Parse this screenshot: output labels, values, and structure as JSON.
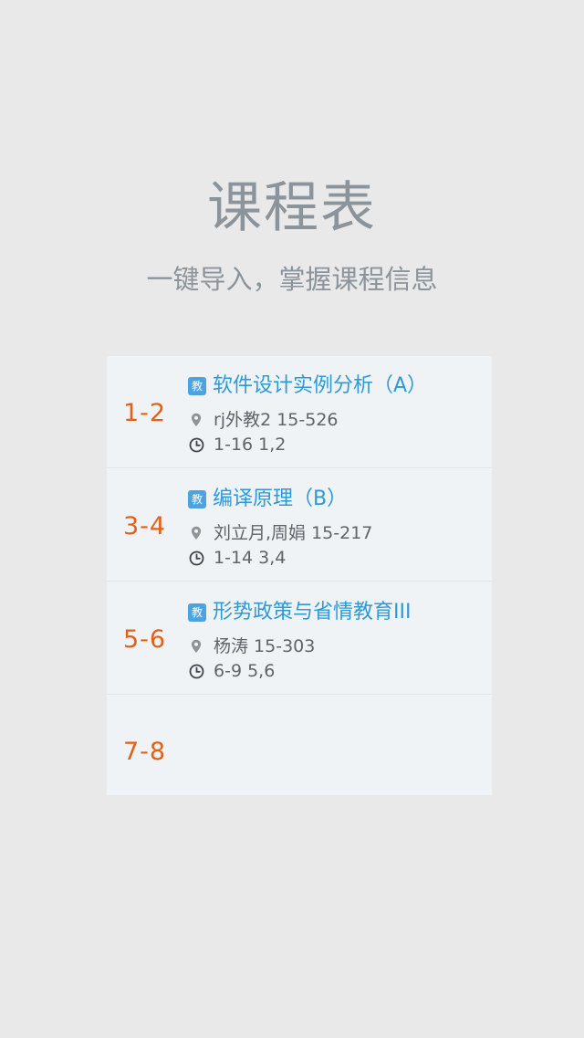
{
  "header": {
    "title": "课程表",
    "subtitle": "一键导入，掌握课程信息"
  },
  "schedule": {
    "rows": [
      {
        "period": "1-2",
        "badge": "教",
        "course": "软件设计实例分析（A）",
        "location": "rj外教2 15-526",
        "time": "1-16 1,2"
      },
      {
        "period": "3-4",
        "badge": "教",
        "course": "编译原理（B）",
        "location": "刘立月,周娟 15-217",
        "time": "1-14 3,4"
      },
      {
        "period": "5-6",
        "badge": "教",
        "course": "形势政策与省情教育III",
        "location": "杨涛 15-303",
        "time": "6-9 5,6"
      },
      {
        "period": "7-8"
      }
    ]
  },
  "colors": {
    "background": "#e9e9e9",
    "card": "#f0f3f5",
    "title": "#8b949a",
    "period": "#e0621a",
    "course": "#2d9ad8",
    "badge": "#4fa3dd",
    "info_text": "#5f6468"
  },
  "icons": {
    "badge": "jiao-badge-icon",
    "location": "location-pin-icon",
    "time": "clock-icon"
  }
}
